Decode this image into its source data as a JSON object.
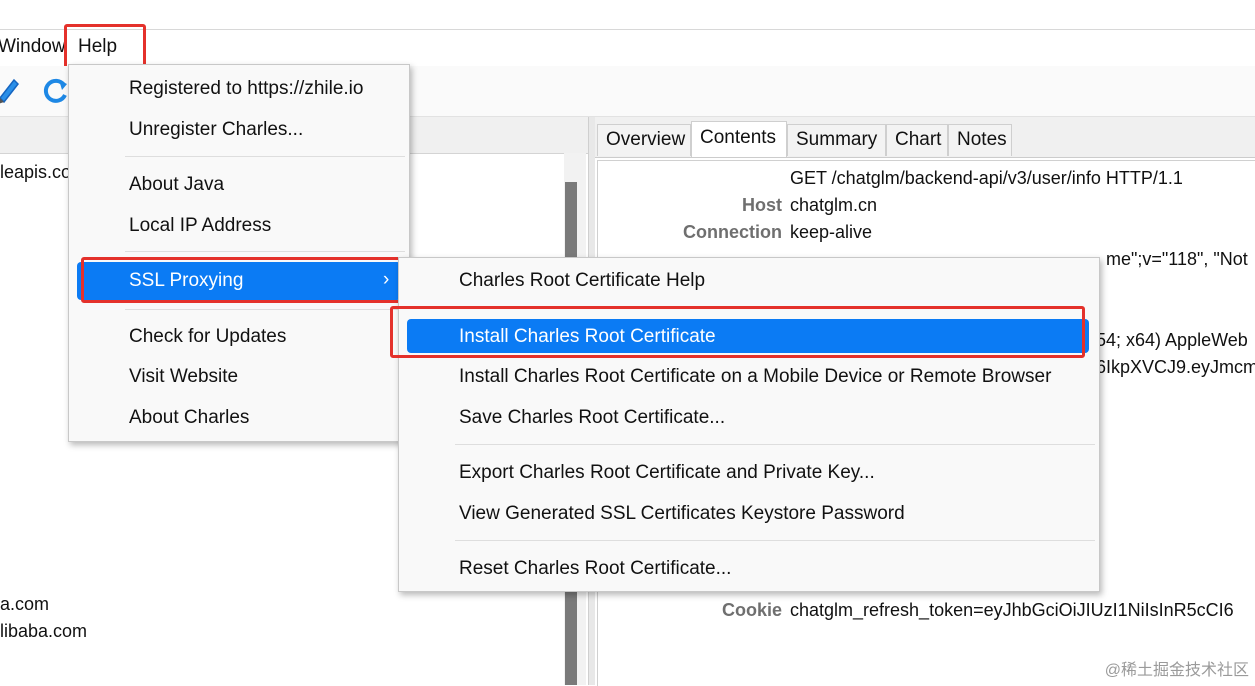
{
  "menubar": {
    "window_label": "Window",
    "help_label": "Help"
  },
  "toolbar": {
    "icons": [
      "pen-icon",
      "refresh-icon"
    ]
  },
  "left_list": {
    "rows": [
      {
        "text": "leapis.co"
      },
      {
        "text": "a.com"
      },
      {
        "text": "libaba.com"
      }
    ]
  },
  "tabs": [
    {
      "label": "Overview"
    },
    {
      "label": "Contents"
    },
    {
      "label": "Summary"
    },
    {
      "label": "Chart"
    },
    {
      "label": "Notes"
    }
  ],
  "request": {
    "request_line": "GET /chatglm/backend-api/v3/user/info HTTP/1.1",
    "headers": [
      {
        "key": "Host",
        "value": "chatglm.cn"
      },
      {
        "key": "Connection",
        "value": "keep-alive"
      },
      {
        "key": "",
        "value": "me\";v=\"118\", \"Not"
      },
      {
        "key": "",
        "value": "54; x64) AppleWeb"
      },
      {
        "key": "",
        "value": "6IkpXVCJ9.eyJmcm"
      },
      {
        "key": "Cookie",
        "value": "chatglm_refresh_token=eyJhbGciOiJIUzI1NiIsInR5cCI6"
      }
    ]
  },
  "help_menu": {
    "items": [
      {
        "label": "Registered to https://zhile.io"
      },
      {
        "label": "Unregister Charles..."
      },
      {
        "label": "About Java"
      },
      {
        "label": "Local IP Address"
      },
      {
        "label": "SSL Proxying",
        "arrow": "›"
      },
      {
        "label": "Check for Updates"
      },
      {
        "label": "Visit Website"
      },
      {
        "label": "About Charles"
      }
    ]
  },
  "ssl_submenu": {
    "items": [
      {
        "label": "Charles Root Certificate Help"
      },
      {
        "label": "Install Charles Root Certificate"
      },
      {
        "label": "Install Charles Root Certificate on a Mobile Device or Remote Browser"
      },
      {
        "label": "Save Charles Root Certificate..."
      },
      {
        "label": "Export Charles Root Certificate and Private Key..."
      },
      {
        "label": "View Generated SSL Certificates Keystore Password"
      },
      {
        "label": "Reset Charles Root Certificate..."
      }
    ]
  },
  "colors": {
    "highlight": "#0b7bf4",
    "annotation_red": "#e4312b"
  },
  "watermark": "@稀土掘金技术社区"
}
